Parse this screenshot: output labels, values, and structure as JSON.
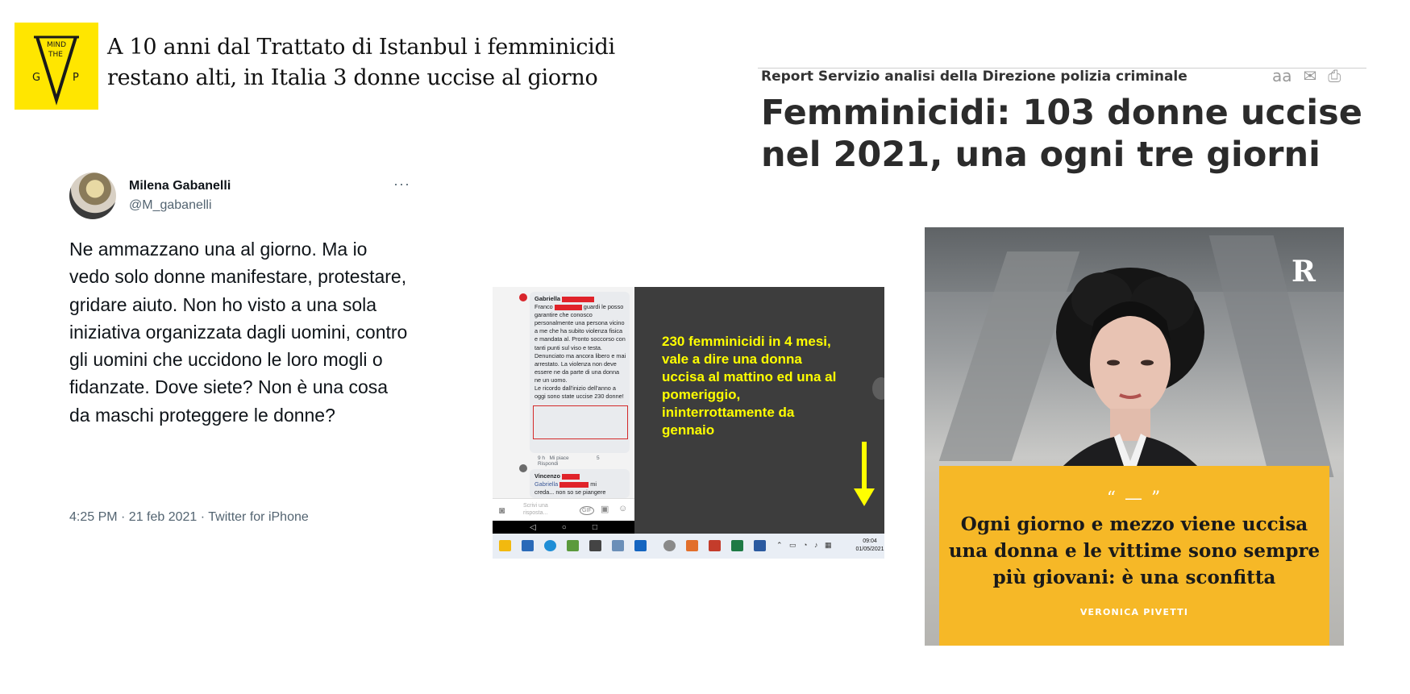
{
  "mind_the_gap": {
    "logo_text": "MIND THE GAP",
    "headline": "A 10 anni dal Trattato di Istanbul i femminicidi restano alti, in Italia 3 donne uccise al giorno"
  },
  "report": {
    "kicker": "Report Servizio analisi della Direzione polizia criminale",
    "headline": "Femminicidi: 103 donne uccise nel 2021, una ogni tre giorni",
    "tools": {
      "text_size": "aa",
      "mail": "✉",
      "print": "⎙"
    }
  },
  "tweet": {
    "author_name": "Milena Gabanelli",
    "author_handle": "@M_gabanelli",
    "more": "···",
    "text": "Ne ammazzano una al giorno. Ma io vedo solo donne manifestare, protestare, gridare aiuto. Non ho visto a una sola iniziativa organizzata dagli uomini, contro gli uomini che uccidono le loro mogli o fidanzate. Dove siete? Non è una cosa da maschi proteggere le donne?",
    "meta": "4:25 PM · 21 feb 2021 · Twitter for iPhone"
  },
  "fb_screenshot": {
    "comment_author": "Gabriella",
    "comment_line1_prefix": "Franco",
    "comment_line1_suffix": "guardi le",
    "comment_body": "posso garantire che conosco personalmente una persona vicino a me che ha subito violenza fisica e mandata al. Pronto soccorso con tanti punti sul viso e testa. Denunciato ma ancora libero e mai arrestato. La violenza non deve essere ne da parte di una donna ne un uomo.",
    "comment_highlight": "Le ricordo dall'inizio dell'anno a oggi sono state uccise 230 donne!",
    "comment_time": "9 h",
    "comment_like": "Mi piace",
    "comment_reply": "Rispondi",
    "comment_reactions": "5",
    "reply_author": "Vincenzo",
    "reply_mention": "Gabriella",
    "reply_suffix": "mi",
    "reply_body": "creda... non so se piangere",
    "input_placeholder": "Scrivi una risposta...",
    "gif_label": "GIF",
    "caption": "230 femminicidi in 4 mesi, vale a dire una donna uccisa al mattino ed una al pomeriggio, ininterrottamente da gennaio",
    "clock_time": "09:04",
    "clock_date": "01/05/2021"
  },
  "repubblica": {
    "logo": "R",
    "quote_marks": "“ — ”",
    "quote": "Ogni giorno e mezzo viene uccisa una donna e le vittime sono sempre più giovani: è una sconfitta",
    "author": "VERONICA PIVETTI",
    "box_color": "#f6b827"
  }
}
